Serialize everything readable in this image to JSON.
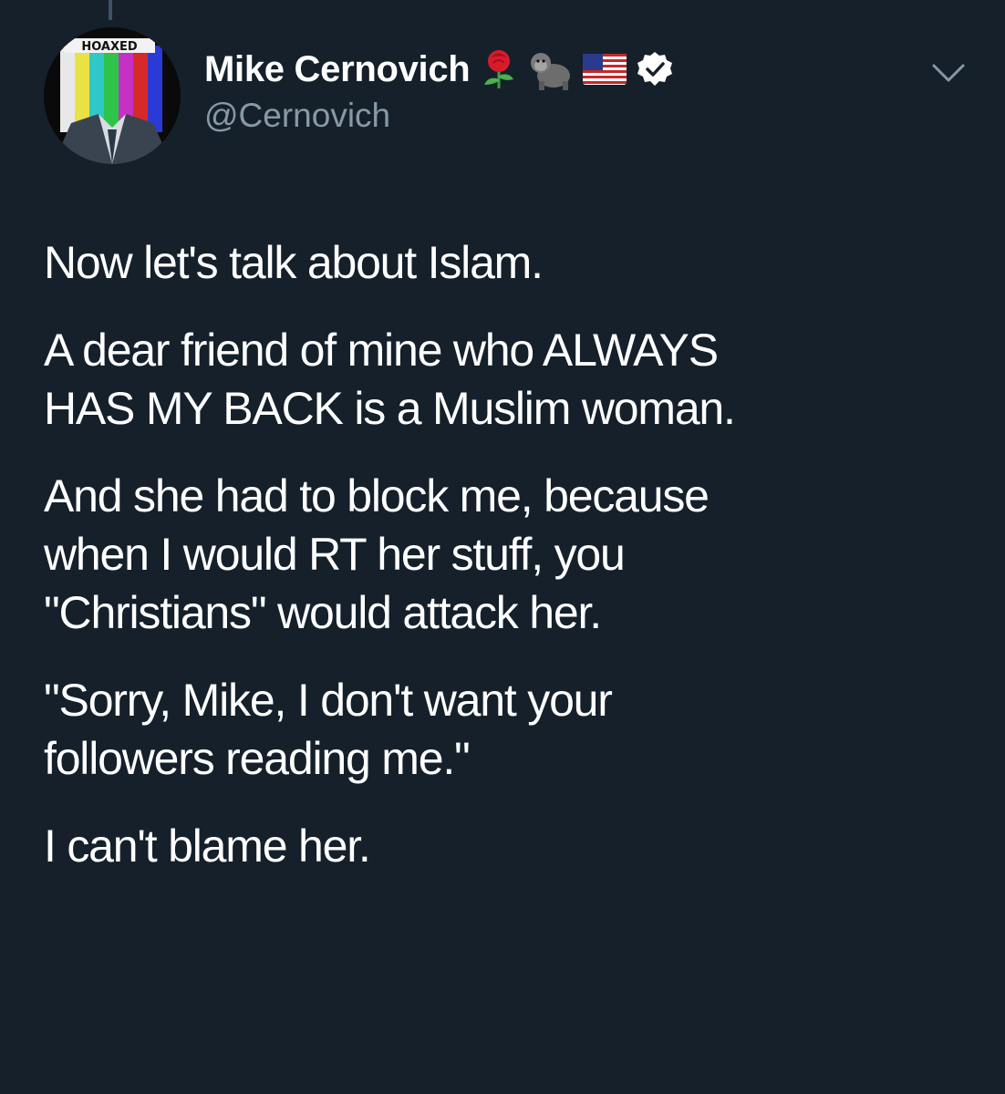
{
  "tweet": {
    "author": {
      "display_name": "Mike Cernovich",
      "handle": "@Cernovich",
      "name_emojis": [
        "rose-icon",
        "gorilla-icon",
        "us-flag-icon"
      ],
      "verified": true,
      "avatar_text": "HOAXED"
    },
    "paragraphs": [
      {
        "lines": [
          "Now let's talk about Islam."
        ]
      },
      {
        "lines": [
          "A dear friend of mine who ALWAYS",
          "HAS MY BACK is a Muslim woman."
        ]
      },
      {
        "lines": [
          "And she had to block me, because",
          "when I would RT her stuff, you",
          "\"Christians\" would attack her."
        ]
      },
      {
        "lines": [
          "\"Sorry, Mike, I don't want your",
          "followers reading me.\""
        ]
      },
      {
        "lines": [
          "I can't blame her."
        ]
      }
    ]
  },
  "colors": {
    "background": "#15202b",
    "text": "#ffffff",
    "secondary_text": "#8899a6",
    "thread_line": "#3d5466"
  }
}
